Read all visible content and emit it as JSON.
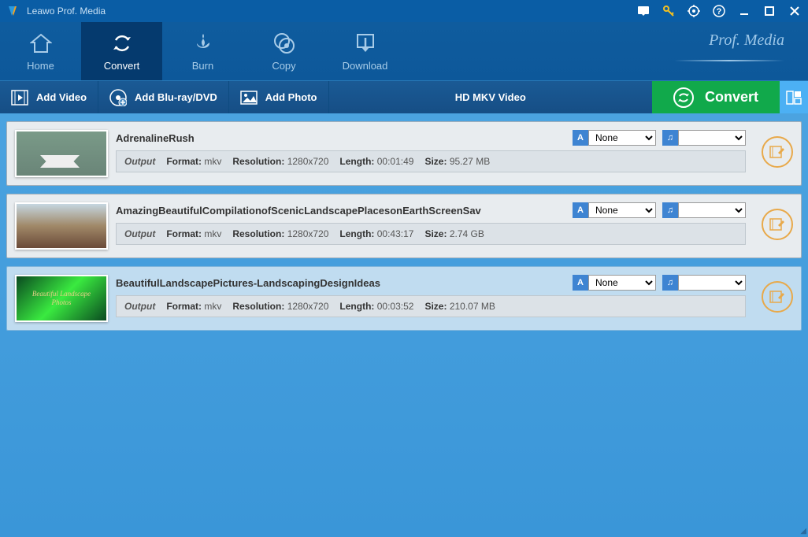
{
  "app_title": "Leawo Prof. Media",
  "tabs": {
    "home": "Home",
    "convert": "Convert",
    "burn": "Burn",
    "copy": "Copy",
    "download": "Download"
  },
  "toolbar": {
    "add_video": "Add Video",
    "add_bluray": "Add Blu-ray/DVD",
    "add_photo": "Add Photo",
    "profile": "HD MKV Video",
    "convert": "Convert"
  },
  "output_label": "Output",
  "labels": {
    "format": "Format:",
    "resolution": "Resolution:",
    "length": "Length:",
    "size": "Size:"
  },
  "items": [
    {
      "title": "AdrenalineRush",
      "format": "mkv",
      "resolution": "1280x720",
      "length": "00:01:49",
      "size": "95.27 MB",
      "subtitle": "None"
    },
    {
      "title": "AmazingBeautifulCompilationofScenicLandscapePlacesonEarthScreenSav",
      "format": "mkv",
      "resolution": "1280x720",
      "length": "00:43:17",
      "size": "2.74 GB",
      "subtitle": "None"
    },
    {
      "title": "BeautifulLandscapePictures-LandscapingDesignIdeas",
      "format": "mkv",
      "resolution": "1280x720",
      "length": "00:03:52",
      "size": "210.07 MB",
      "subtitle": "None"
    }
  ],
  "prof_media": "Prof. Media"
}
